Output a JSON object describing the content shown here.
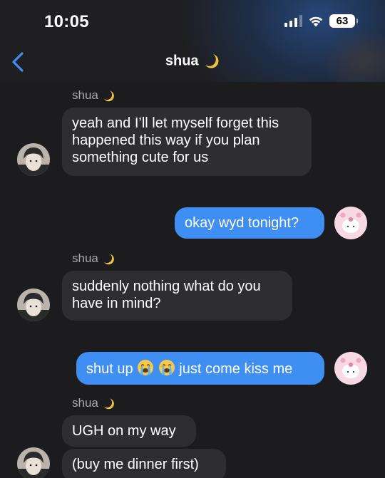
{
  "status_bar": {
    "time": "10:05",
    "battery": "63"
  },
  "nav": {
    "contact_name": "shua",
    "contact_emoji": "moon-icon"
  },
  "messages": [
    {
      "sender": "shua",
      "lines": [
        "yeah and I’ll let myself forget this",
        "happened this way if you plan",
        "something cute for us"
      ]
    },
    {
      "text": "okay wyd tonight?"
    },
    {
      "sender": "shua",
      "lines": [
        "suddenly nothing what do you",
        "have in mind?"
      ]
    },
    {
      "text_before": "shut up",
      "text_after": "just come kiss me"
    },
    {
      "sender": "shua",
      "text": "UGH on my way"
    },
    {
      "text": "(buy me dinner first)"
    }
  ],
  "colors": {
    "background": "#1c1c1e",
    "incoming_bubble": "#2e2e31",
    "outgoing_bubble": "#3f8ef3",
    "accent": "#3f8ef3"
  }
}
